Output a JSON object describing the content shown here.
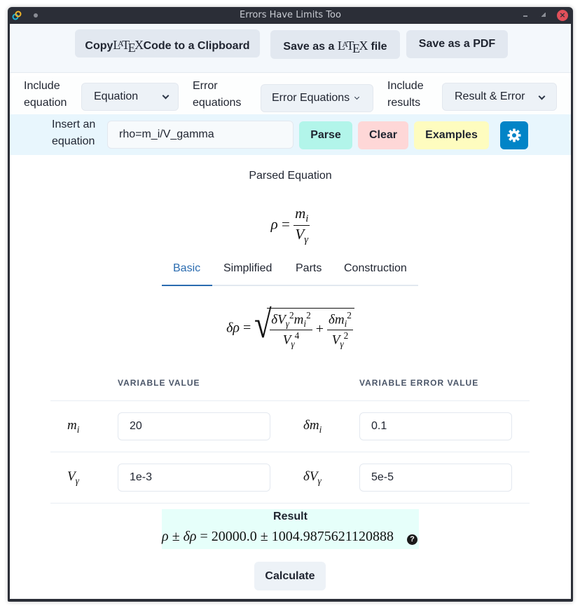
{
  "window": {
    "title": "Errors Have Limits Too"
  },
  "toolbar": {
    "copy_prefix": "Copy",
    "copy_suffix": "Code to a Clipboard",
    "save_tex_prefix": "Save as a ",
    "save_tex_suffix": " file",
    "save_pdf": "Save as a PDF",
    "latex_logo": {
      "l": "L",
      "a": "A",
      "t": "T",
      "e": "E",
      "x": "X"
    }
  },
  "options": {
    "include_equation_label": [
      "Include",
      "equation"
    ],
    "include_equation_value": "Equation",
    "error_equations_label": [
      "Error",
      "equations"
    ],
    "error_equations_value": "Error Equations",
    "include_results_label": [
      "Include",
      "results"
    ],
    "include_results_value": "Result & Error"
  },
  "input_bar": {
    "label": [
      "Insert an",
      "equation"
    ],
    "equation_value": "rho=m_i/V_gamma",
    "parse": "Parse",
    "clear": "Clear",
    "examples": "Examples",
    "settings_icon": "gear-icon",
    "colors": {
      "parse": "#b2f5ea",
      "clear": "#fed7d7",
      "examples": "#fefcbf",
      "settings": "#0284c7"
    }
  },
  "parsed": {
    "title": "Parsed Equation",
    "lhs": "ρ",
    "num": "m",
    "num_sub": "i",
    "den": "V",
    "den_sub": "γ"
  },
  "tabs": {
    "items": [
      "Basic",
      "Simplified",
      "Parts",
      "Construction"
    ],
    "active": "Basic",
    "active_color": "#2b6cb0"
  },
  "error_equation": {
    "lhs": "δρ",
    "term1_num": "δV",
    "term1_den": "V",
    "term2_num": "δm",
    "term2_den": "V"
  },
  "variables": {
    "header_value": "VARIABLE VALUE",
    "header_error": "VARIABLE ERROR VALUE",
    "rows": [
      {
        "name": "m",
        "sub": "i",
        "value": "20",
        "error_name": "δm",
        "error_value": "0.1"
      },
      {
        "name": "V",
        "sub": "γ",
        "value": "1e-3",
        "error_name": "δV",
        "error_value": "5e-5"
      }
    ]
  },
  "result": {
    "title": "Result",
    "lhs": "ρ ± δρ",
    "value": "20000.0",
    "pm": "±",
    "error": "1004.9875621120888",
    "help_icon": "question-circle-icon"
  },
  "calculate": "Calculate"
}
